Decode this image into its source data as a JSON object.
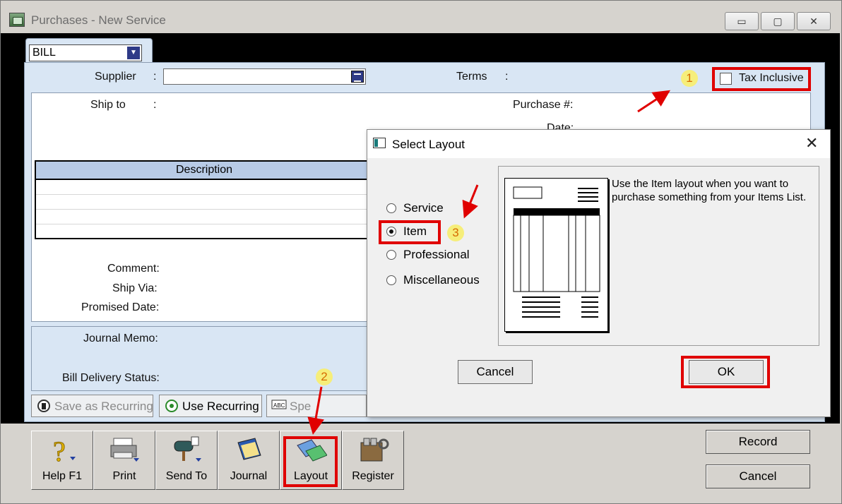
{
  "window": {
    "title": "Purchases - New Service",
    "controls": {
      "minimize": "▭",
      "maximize": "▢",
      "close": "✕"
    }
  },
  "form": {
    "type_value": "BILL",
    "supplier_label": "Supplier",
    "colon": ":",
    "terms_label": "Terms",
    "tax_inclusive_label": "Tax Inclusive",
    "tax_inclusive_checked": false,
    "ship_to_label": "Ship to",
    "purchase_no_label": "Purchase #:",
    "date_label": "Date:",
    "grid_header": "Description",
    "comment_label": "Comment:",
    "ship_via_label": "Ship Via:",
    "promised_date_label": "Promised Date:",
    "journal_memo_label": "Journal Memo:",
    "bill_delivery_label": "Bill Delivery Status:"
  },
  "toolbar_small": {
    "save_recurring": "Save as Recurring",
    "use_recurring": "Use Recurring",
    "spell": "Spe"
  },
  "toolbar_big": [
    {
      "label": "Help F1",
      "icon": "help-icon"
    },
    {
      "label": "Print",
      "icon": "printer-icon"
    },
    {
      "label": "Send To",
      "icon": "mailbox-icon"
    },
    {
      "label": "Journal",
      "icon": "journal-icon"
    },
    {
      "label": "Layout",
      "icon": "layout-icon"
    },
    {
      "label": "Register",
      "icon": "register-icon"
    }
  ],
  "actions": {
    "record": "Record",
    "cancel": "Cancel"
  },
  "dialog": {
    "title": "Select Layout",
    "close": "✕",
    "options": [
      "Service",
      "Item",
      "Professional",
      "Miscellaneous"
    ],
    "selected": "Item",
    "description": "Use the Item layout when you want to purchase something from your Items List.",
    "cancel": "Cancel",
    "ok": "OK"
  },
  "annotations": {
    "m1": "1",
    "m2": "2",
    "m3": "3"
  },
  "colors": {
    "highlight": "#e00000",
    "marker_bg": "#f6ee7a",
    "form_bg": "#d9e6f4"
  }
}
